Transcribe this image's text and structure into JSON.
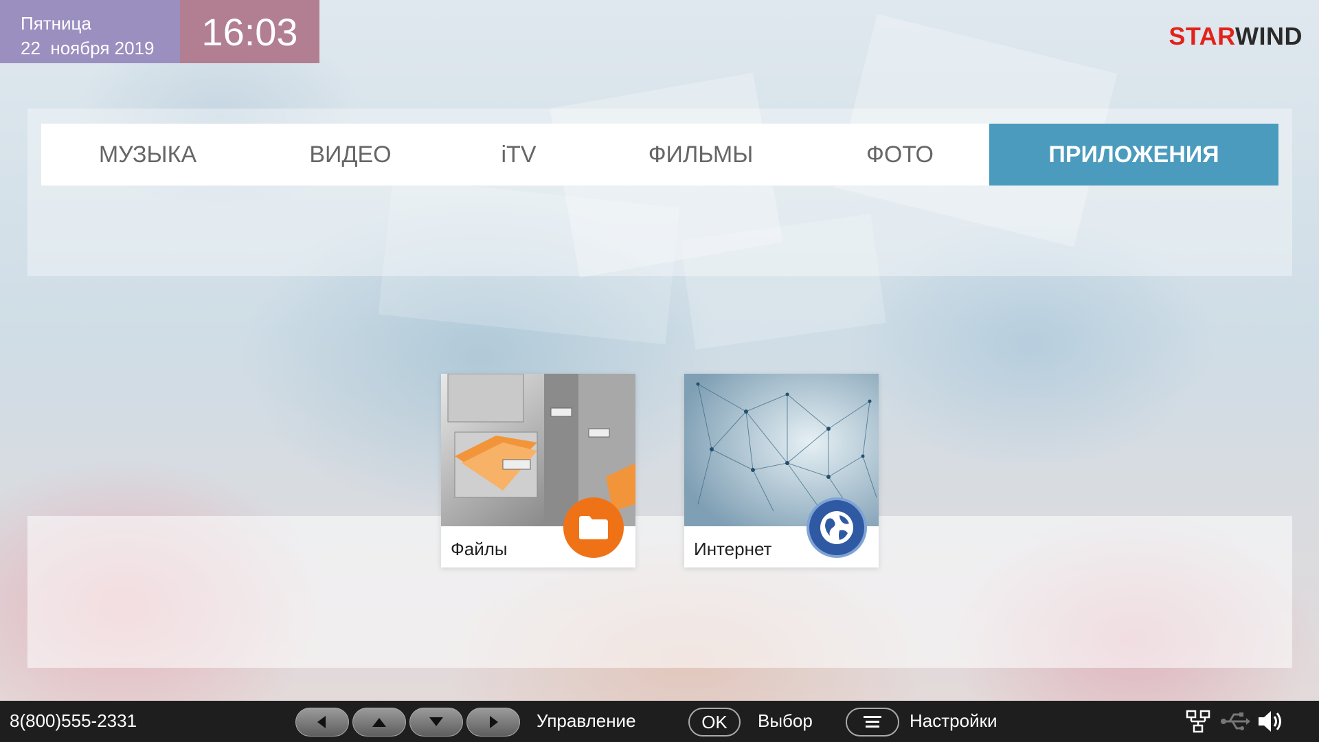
{
  "datetime": {
    "weekday": "Пятница",
    "date": "22  ноября 2019",
    "time": "16:03"
  },
  "brand": {
    "logo_part1": "STAR",
    "logo_part2": "WIND"
  },
  "tabs": [
    {
      "label": "МУЗЫКА",
      "active": false
    },
    {
      "label": "ВИДЕО",
      "active": false
    },
    {
      "label": "iTV",
      "active": false
    },
    {
      "label": "ФИЛЬМЫ",
      "active": false
    },
    {
      "label": "ФОТО",
      "active": false
    },
    {
      "label": "ПРИЛОЖЕНИЯ",
      "active": true
    }
  ],
  "apps": [
    {
      "label": "Файлы",
      "icon": "folder-icon",
      "accent": "#f07217"
    },
    {
      "label": "Интернет",
      "icon": "globe-icon",
      "accent": "#2f5aa3"
    }
  ],
  "footer": {
    "phone": "8(800)555-2331",
    "control_label": "Управление",
    "ok_label": "OK",
    "select_label": "Выбор",
    "settings_label": "Настройки",
    "icons": [
      "network-icon",
      "usb-icon",
      "volume-icon"
    ]
  },
  "colors": {
    "active_tab": "#4a9bbd",
    "date_bg": "#9b8fc0",
    "time_bg": "#b27e92",
    "logo_red": "#e32219"
  }
}
